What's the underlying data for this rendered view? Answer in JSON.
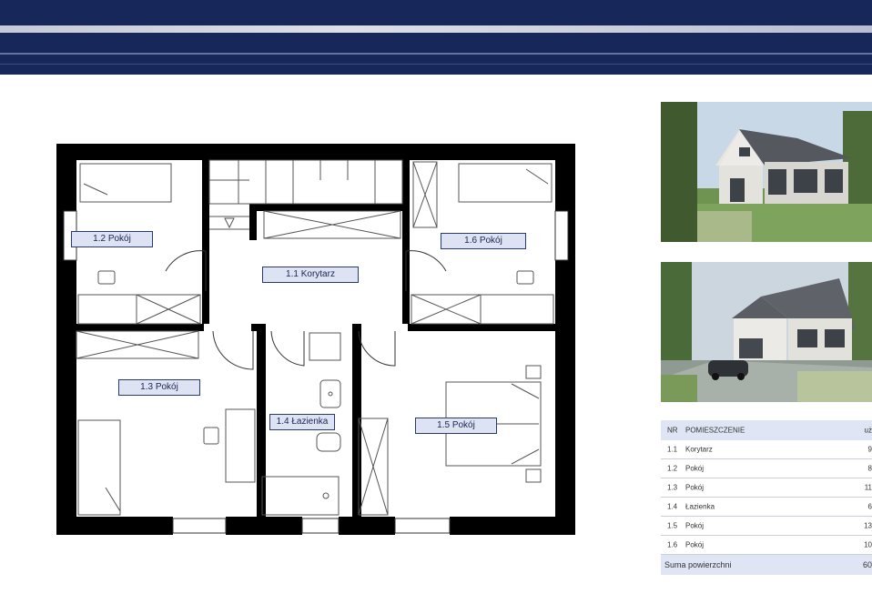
{
  "rooms": [
    {
      "nr": "1.1",
      "name": "Korytarz",
      "label": "1.1 Korytarz",
      "area": "9"
    },
    {
      "nr": "1.2",
      "name": "Pokój",
      "label": "1.2 Pokój",
      "area": "8"
    },
    {
      "nr": "1.3",
      "name": "Pokój",
      "label": "1.3 Pokój",
      "area": "11"
    },
    {
      "nr": "1.4",
      "name": "Łazienka",
      "label": "1.4 Łazienka",
      "area": "6"
    },
    {
      "nr": "1.5",
      "name": "Pokój",
      "label": "1.5 Pokój",
      "area": "13"
    },
    {
      "nr": "1.6",
      "name": "Pokój",
      "label": "1.6 Pokój",
      "area": "10"
    }
  ],
  "table": {
    "col_nr": "NR",
    "col_room": "POMIESZCZENIE",
    "col_area": "uż",
    "sum_label": "Suma powierzchni",
    "sum_value": "60"
  },
  "colors": {
    "banner": "#17275a",
    "label_fill": "#dde3f3",
    "table_fill": "#dfe5f4",
    "wall": "#000000"
  }
}
